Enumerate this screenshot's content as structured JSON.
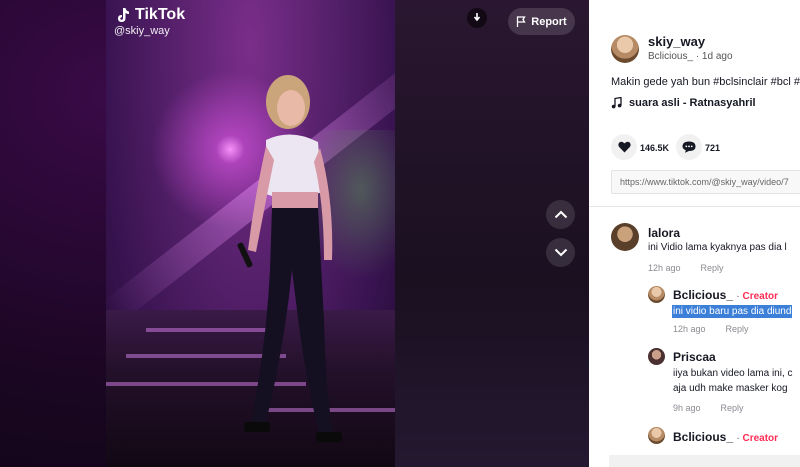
{
  "video": {
    "brand": "TikTok",
    "handle": "@skiy_way",
    "report_label": "Report"
  },
  "author": {
    "username": "skiy_way",
    "nickname": "Bclicious_",
    "time": "1d ago"
  },
  "description": "Makin gede yah bun #bclsinclair #bcl #",
  "music": "suara asli - Ratnasyahril",
  "stats": {
    "likes": "146.5K",
    "comments": "721"
  },
  "link": "https://www.tiktok.com/@skiy_way/video/7",
  "comments": [
    {
      "name": "lalora",
      "text": "ini Vidio lama kyaknya pas dia l",
      "time": "12h ago",
      "reply": "Reply"
    }
  ],
  "replies": [
    {
      "name": "Bclicious_",
      "tag": "Creator",
      "text": "ini vidio baru pas dia diund",
      "time": "12h ago",
      "reply": "Reply"
    },
    {
      "name": "Priscaa",
      "text_line1": "iiya bukan video lama ini, c",
      "text_line2": "aja udh make masker kog",
      "time": "9h ago",
      "reply": "Reply"
    },
    {
      "name": "Bclicious_",
      "tag": "Creator"
    }
  ],
  "colors": {
    "accent": "#fe2c55",
    "highlight": "#3b7fd9"
  },
  "icons": [
    "tiktok-logo-icon",
    "mute-icon",
    "flag-icon",
    "chevron-up-icon",
    "chevron-down-icon",
    "music-note-icon",
    "heart-icon",
    "comment-icon"
  ]
}
